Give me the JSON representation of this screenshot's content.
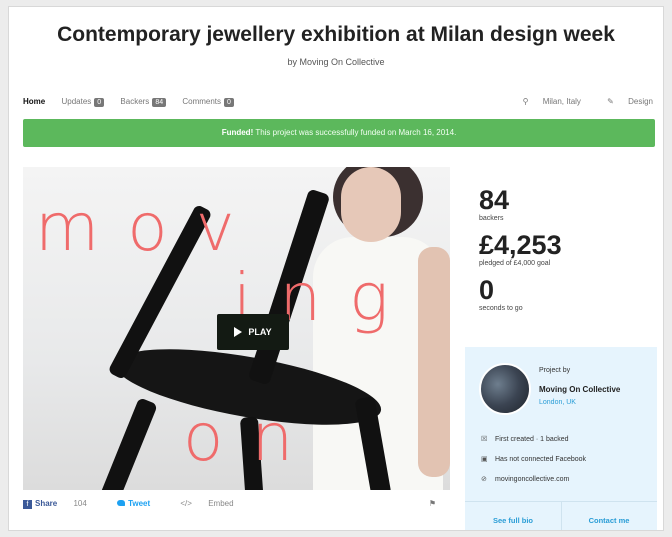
{
  "header": {
    "title": "Contemporary jewellery exhibition at Milan design week",
    "byline": "by Moving On Collective"
  },
  "nav": {
    "tabs": [
      {
        "label": "Home",
        "count": ""
      },
      {
        "label": "Updates",
        "count": "0"
      },
      {
        "label": "Backers",
        "count": "84"
      },
      {
        "label": "Comments",
        "count": "0"
      }
    ],
    "location": "Milan, Italy",
    "category": "Design",
    "location_icon": "map-pin-icon",
    "category_icon": "tag-icon"
  },
  "banner": {
    "strong": "Funded!",
    "text": "This project was successfully funded on March 16, 2014.",
    "color": "#5cb85c"
  },
  "video": {
    "overlay_words": [
      "mov",
      "ing",
      "on"
    ],
    "play_label": "PLAY"
  },
  "share": {
    "facebook_label": "Share",
    "facebook_count": "104",
    "twitter_label": "Tweet",
    "embed_label": "Embed"
  },
  "stats": {
    "backers_value": "84",
    "backers_label": "backers",
    "pledged_value": "£4,253",
    "pledged_label": "pledged of £4,000 goal",
    "time_value": "0",
    "time_label": "seconds to go"
  },
  "creator": {
    "project_by": "Project by",
    "name": "Moving On Collective",
    "location": "London, UK",
    "first_created": "First created · 1 backed",
    "facebook": "Has not connected Facebook",
    "website": "movingoncollective.com",
    "see_bio": "See full bio",
    "contact": "Contact me"
  },
  "colors": {
    "accent_blue": "#2a9dd6",
    "overlay_pink": "#ef6b6b",
    "creator_bg": "#e6f4fd"
  }
}
